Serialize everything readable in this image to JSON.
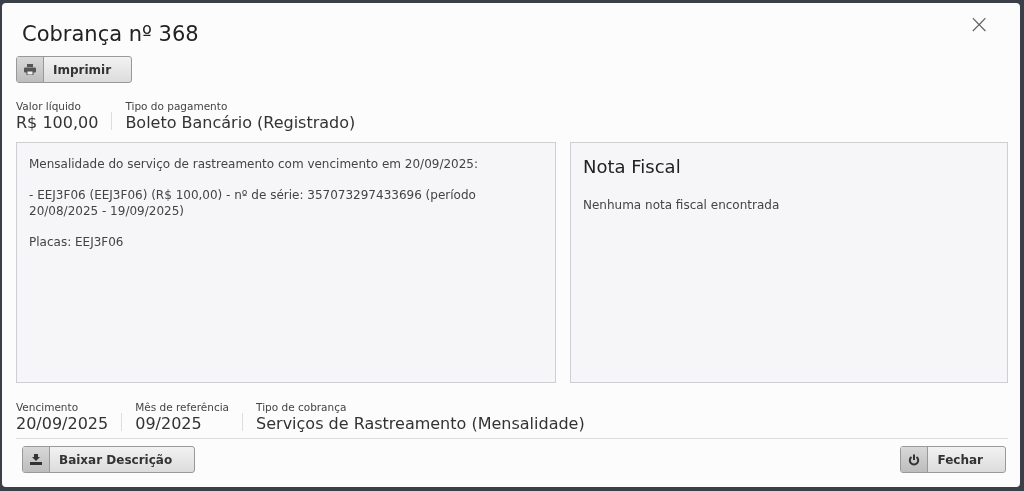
{
  "dialog": {
    "title": "Cobrança nº 368",
    "close": "×"
  },
  "print_button": {
    "label": "Imprimir"
  },
  "top_fields": [
    {
      "label": "Valor líquido",
      "value": "R$ 100,00"
    },
    {
      "label": "Tipo do pagamento",
      "value": "Boleto Bancário (Registrado)"
    }
  ],
  "description": [
    "Mensalidade do serviço de rastreamento com vencimento em 20/09/2025:",
    "- EEJ3F06 (EEJ3F06) (R$ 100,00) - nº de série: 357073297433696 (período 20/08/2025 - 19/09/2025)",
    "Placas: EEJ3F06"
  ],
  "invoice": {
    "title": "Nota Fiscal",
    "message": "Nenhuma nota fiscal encontrada"
  },
  "bottom_fields": [
    {
      "label": "Vencimento",
      "value": "20/09/2025"
    },
    {
      "label": "Mês de referência",
      "value": "09/2025"
    },
    {
      "label": "Tipo de cobrança",
      "value": "Serviços de Rastreamento (Mensalidade)"
    }
  ],
  "footer_buttons": [
    {
      "label": "Baixar Descrição",
      "kind": "download"
    },
    {
      "label": "Fechar",
      "kind": "power"
    }
  ]
}
